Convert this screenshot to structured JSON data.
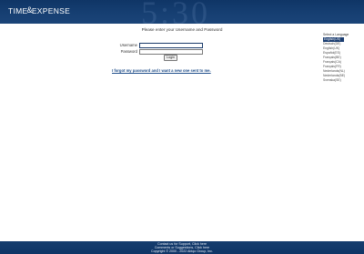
{
  "header": {
    "logo_part1": "TIME",
    "logo_amp": "&",
    "logo_part2": "EXPENSE",
    "background_color": "#163f72"
  },
  "login": {
    "prompt": "Please enter your Username and Password",
    "username_label": "Username",
    "username_value": "",
    "password_label": "Password",
    "password_value": "",
    "login_button": "Login",
    "forgot_link": "I forgot my password and I want a new one sent to me."
  },
  "languages": {
    "title": "Select a Language",
    "items": [
      "English(US)",
      "Deutsch(DE)",
      "English(UK)",
      "Español(ES)",
      "Français(BE)",
      "Français(CA)",
      "Français(FR)",
      "Nederlands(NL)",
      "Nederlands(BE)",
      "Svenska(SE)"
    ],
    "selected_index": 0,
    "selected_color": "#1b3d70"
  },
  "footer": {
    "line1": "Contact us for Support, Click here",
    "line2": "Comments or Suggestions, Click here",
    "line3": "Copyright © 2000 - 2022 Abiqo Group, Inc."
  }
}
